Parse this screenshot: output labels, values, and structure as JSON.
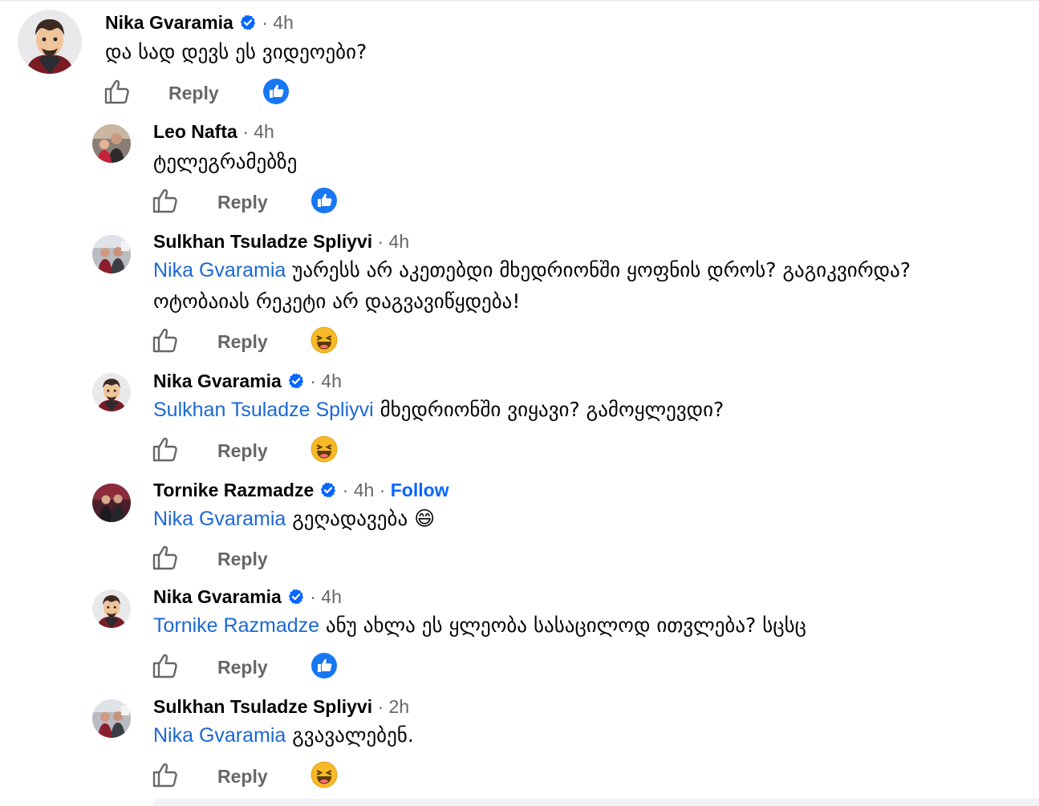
{
  "comments": [
    {
      "author": "Nika Gvaramia",
      "verified": true,
      "time": "4h",
      "mention": "",
      "text": "და სად დევს ეს ვიდეოები?",
      "reply_label": "Reply",
      "reaction": "like"
    },
    {
      "author": "Leo Nafta",
      "verified": false,
      "time": "4h",
      "mention": "",
      "text": "ტელეგრამებზე",
      "reply_label": "Reply",
      "reaction": "like"
    },
    {
      "author": "Sulkhan Tsuladze Spliyvi",
      "verified": false,
      "time": "4h",
      "mention": "Nika Gvaramia",
      "text": "უარესს არ აკეთებდი მხედრიონში ყოფნის დროს? გაგიკვირდა?",
      "text_line2": "ოტობაიას რეკეტი არ დაგვავიწყდება!",
      "reply_label": "Reply",
      "reaction": "haha"
    },
    {
      "author": "Nika Gvaramia",
      "verified": true,
      "time": "4h",
      "mention": "Sulkhan Tsuladze Spliyvi",
      "text": "მხედრიონში ვიყავი? გამოყლევდი?",
      "reply_label": "Reply",
      "reaction": "haha"
    },
    {
      "author": "Tornike Razmadze",
      "verified": true,
      "time": "4h",
      "follow": "Follow",
      "mention": "Nika Gvaramia",
      "text": "გეღადავება 😄",
      "reply_label": "Reply",
      "reaction": "none"
    },
    {
      "author": "Nika Gvaramia",
      "verified": true,
      "time": "4h",
      "mention": "Tornike Razmadze",
      "text": "ანუ ახლა ეს ყლეობა სასაცილოდ ითვლება? სცსც",
      "reply_label": "Reply",
      "reaction": "like"
    },
    {
      "author": "Sulkhan Tsuladze Spliyvi",
      "verified": false,
      "time": "2h",
      "mention": "Nika Gvaramia",
      "text": "გვავალებენ.",
      "reply_label": "Reply",
      "reaction": "haha"
    }
  ],
  "separator": "·",
  "colors": {
    "mention": "#1b68d4",
    "meta": "#65676b",
    "like_blue": "#1877f2",
    "haha_yellow": "#f7b928"
  },
  "icons": {
    "like_outline": "thumbs-up-outline-icon",
    "verified": "verified-badge-icon",
    "like_reaction": "like-reaction-icon",
    "haha_reaction": "haha-reaction-icon"
  }
}
